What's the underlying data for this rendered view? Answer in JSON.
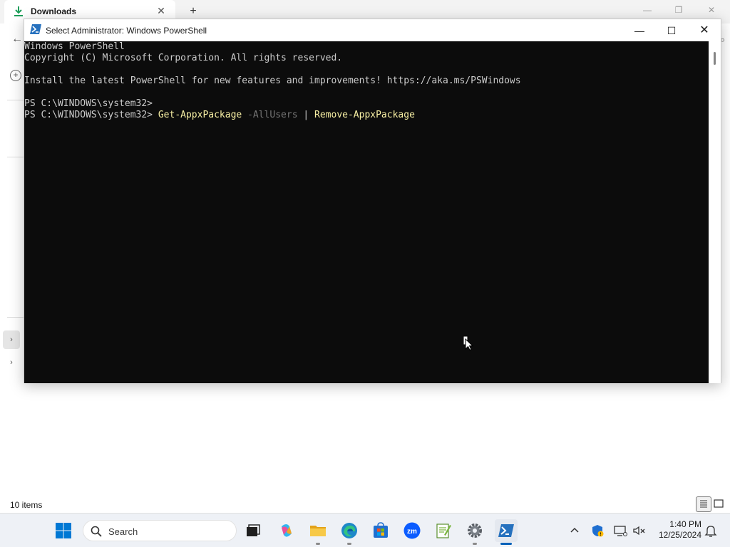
{
  "explorer": {
    "tab_label": "Downloads",
    "tab_close": "✕",
    "new_tab": "+",
    "status_items": "10 items"
  },
  "powershell": {
    "title": "Select Administrator: Windows PowerShell",
    "lines": [
      "Windows PowerShell",
      "Copyright (C) Microsoft Corporation. All rights reserved.",
      "",
      "Install the latest PowerShell for new features and improvements! https://aka.ms/PSWindows",
      "",
      "PS C:\\WINDOWS\\system32>"
    ],
    "command_line": {
      "prompt": "PS C:\\WINDOWS\\system32> ",
      "cmd1": "Get-AppxPackage",
      "param": " -AllUsers",
      "pipe": " | ",
      "cmd2": "Remove-AppxPackage"
    },
    "colors": {
      "background": "#0c0c0c",
      "text": "#cccccc",
      "command": "#f9f1a5",
      "parameter": "#767676"
    }
  },
  "taskbar": {
    "search_label": "Search",
    "time": "1:40 PM",
    "date": "12/25/2024",
    "apps": [
      "start-icon",
      "search-icon",
      "task-view-icon",
      "copilot-icon",
      "file-explorer-icon",
      "edge-icon",
      "microsoft-store-icon",
      "zoom-icon",
      "notepad-plus-icon",
      "settings-icon",
      "powershell-icon"
    ],
    "tray": [
      "chevron-up-icon",
      "defender-shield-icon",
      "network-icon",
      "volume-muted-icon",
      "notification-bell-icon"
    ],
    "accent": "#005fb8"
  }
}
